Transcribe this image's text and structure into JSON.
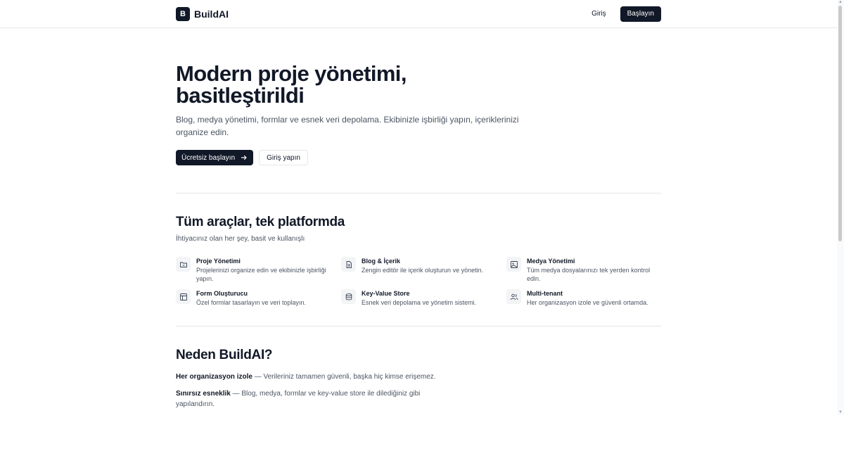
{
  "header": {
    "logo_letter": "B",
    "brand": "BuildAI",
    "login": "Giriş",
    "cta": "Başlayın"
  },
  "hero": {
    "title": "Modern proje yönetimi, basitleştirildi",
    "description": "Blog, medya yönetimi, formlar ve esnek veri depolama. Ekibinizle işbirliği yapın, içeriklerinizi organize edin.",
    "primary_button": "Ücretsiz başlayın",
    "secondary_button": "Giriş yapın"
  },
  "features": {
    "title": "Tüm araçlar, tek platformda",
    "subtitle": "İhtiyacınız olan her şey, basit ve kullanışlı",
    "items": [
      {
        "icon": "folder-icon",
        "title": "Proje Yönetimi",
        "desc": "Projelerinizi organize edin ve ekibinizle işbirliği yapın."
      },
      {
        "icon": "document-icon",
        "title": "Blog & İçerik",
        "desc": "Zengin editör ile içerik oluşturun ve yönetin."
      },
      {
        "icon": "image-icon",
        "title": "Medya Yönetimi",
        "desc": "Tüm medya dosyalarınızı tek yerden kontrol edin."
      },
      {
        "icon": "layout-icon",
        "title": "Form Oluşturucu",
        "desc": "Özel formlar tasarlayın ve veri toplayın."
      },
      {
        "icon": "database-icon",
        "title": "Key-Value Store",
        "desc": "Esnek veri depolama ve yönetim sistemi."
      },
      {
        "icon": "users-icon",
        "title": "Multi-tenant",
        "desc": "Her organizasyon izole ve güvenli ortamda."
      }
    ]
  },
  "why": {
    "title": "Neden BuildAI?",
    "items": [
      {
        "strong": "Her organizasyon izole",
        "text": " — Verileriniz tamamen güvenli, başka hiç kimse erişemez."
      },
      {
        "strong": "Sınırsız esneklik",
        "text": " — Blog, medya, formlar ve key-value store ile dilediğiniz gibi yapılandırın."
      }
    ]
  },
  "colors": {
    "primary": "#111827",
    "text_muted": "#4b5563",
    "border": "#e5e7eb",
    "icon_bg": "#f3f4f6"
  }
}
